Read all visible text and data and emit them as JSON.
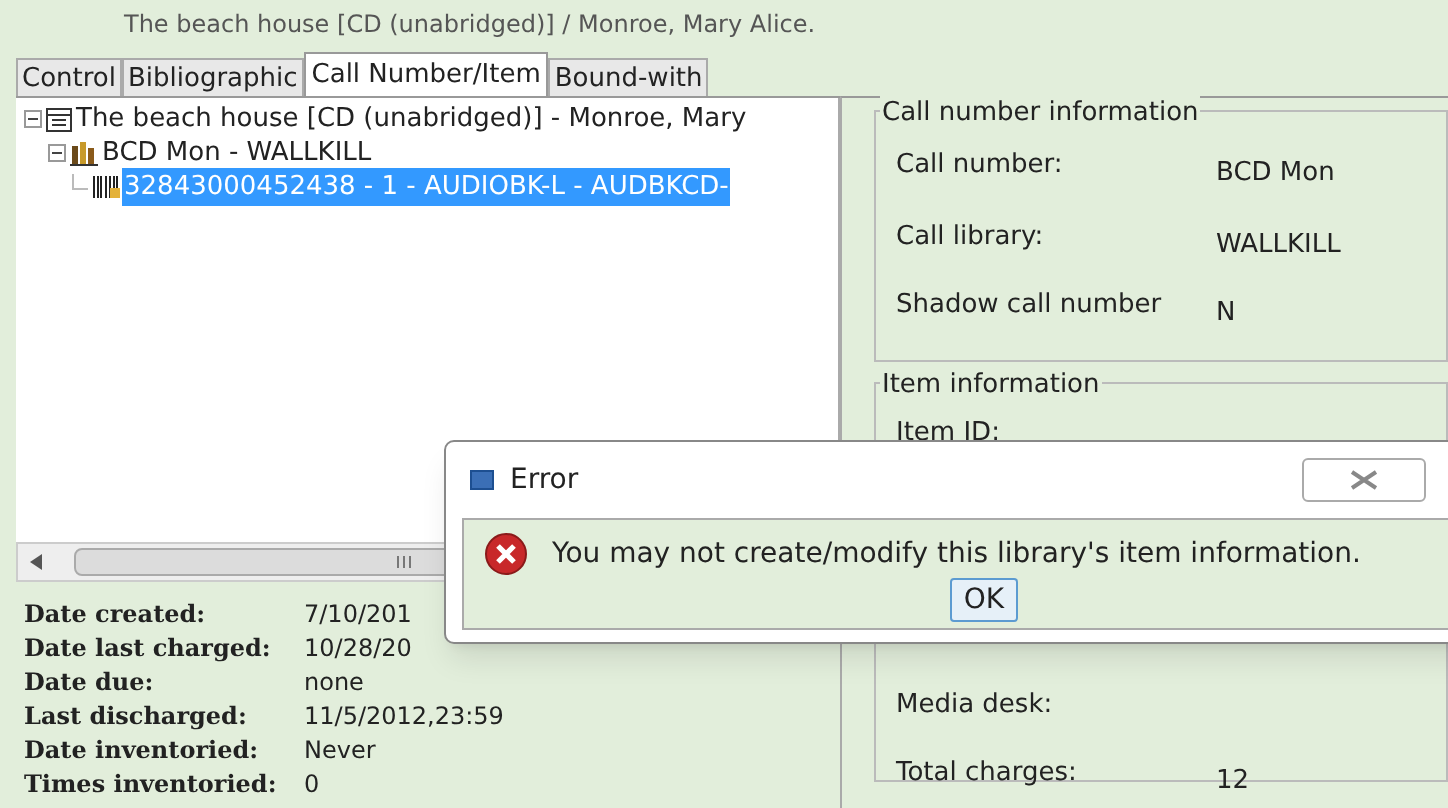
{
  "header": {
    "title": "The beach house [CD (unabridged)] / Monroe, Mary Alice."
  },
  "tabs": [
    {
      "label": "Control",
      "selected": false
    },
    {
      "label": "Bibliographic",
      "selected": false
    },
    {
      "label": "Call Number/Item",
      "selected": true
    },
    {
      "label": "Bound-with",
      "selected": false
    }
  ],
  "tree": [
    {
      "label": "The beach house [CD (unabridged)] - Monroe, Mary",
      "kind": "title",
      "expanded": true,
      "selected": false,
      "children": [
        {
          "label": "BCD Mon - WALLKILL",
          "kind": "callnumber",
          "expanded": true,
          "selected": false,
          "children": [
            {
              "label": "32843000452438 - 1 - AUDIOBK-L - AUDBKCD-",
              "kind": "item",
              "selected": true
            }
          ]
        }
      ]
    }
  ],
  "details": [
    {
      "label": "Date created:",
      "value": "7/10/201"
    },
    {
      "label": "Date last charged:",
      "value": "10/28/20"
    },
    {
      "label": "Date due:",
      "value": "none"
    },
    {
      "label": "Last discharged:",
      "value": "11/5/2012,23:59"
    },
    {
      "label": "Date inventoried:",
      "value": "Never"
    },
    {
      "label": "Times inventoried:",
      "value": "0"
    }
  ],
  "call_number_information": {
    "title": "Call number information",
    "fields": [
      {
        "label": "Call number:",
        "value": "BCD Mon"
      },
      {
        "label": "Call library:",
        "value": "WALLKILL"
      },
      {
        "label": "Shadow call number",
        "value": "N"
      }
    ]
  },
  "item_information": {
    "title": "Item information",
    "fields": [
      {
        "label": "Item ID:"
      },
      {
        "label": "Media desk:"
      },
      {
        "label": "Total charges:",
        "value": "12"
      }
    ]
  },
  "dialog": {
    "title": "Error",
    "message": "You may not create/modify this library's item information.",
    "button": "OK"
  }
}
